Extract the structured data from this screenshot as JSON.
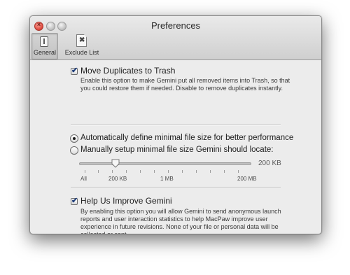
{
  "window": {
    "title": "Preferences",
    "toolbar": [
      {
        "label": "General",
        "icon": "general-switch-icon",
        "selected": true
      },
      {
        "label": "Exclude List",
        "icon": "exclude-document-icon",
        "selected": false
      }
    ]
  },
  "trash": {
    "label": "Move Duplicates to Trash",
    "checked": true,
    "description": "Enable this option to make Gemini put all removed items into Trash, so that you could restore them if needed. Disable to remove duplicates instantly."
  },
  "filesize": {
    "auto_label": "Automatically define minimal file size for better performance",
    "manual_label": "Manually setup minimal file size Gemini should locate:",
    "selected": "auto",
    "slider": {
      "value_label": "200 KB",
      "value_fraction": 0.21,
      "tick_labels": [
        "All",
        "200 KB",
        "1 MB",
        "200 MB"
      ]
    }
  },
  "improve": {
    "label": "Help Us Improve Gemini",
    "checked": true,
    "description": "By enabling this option you will allow Gemini to send anonymous launch reports and user interaction statistics to help MacPaw improve user experience in future revisions. None of your file or personal data will be collected or sent."
  }
}
